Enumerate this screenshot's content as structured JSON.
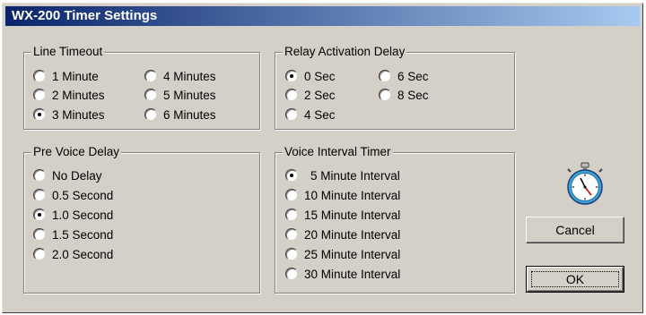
{
  "window": {
    "title": "WX-200 Timer Settings"
  },
  "line_timeout": {
    "label": "Line Timeout",
    "options": [
      "1 Minute",
      "2 Minutes",
      "3 Minutes",
      "4 Minutes",
      "5 Minutes",
      "6 Minutes"
    ],
    "selected": "3 Minutes"
  },
  "relay_activation_delay": {
    "label": "Relay Activation Delay",
    "options": [
      "0 Sec",
      "2 Sec",
      "4 Sec",
      "6 Sec",
      "8 Sec"
    ],
    "selected": "0 Sec"
  },
  "pre_voice_delay": {
    "label": "Pre Voice Delay",
    "options": [
      "No Delay",
      "0.5 Second",
      "1.0 Second",
      "1.5 Second",
      "2.0 Second"
    ],
    "selected": "1.0 Second"
  },
  "voice_interval_timer": {
    "label": "Voice Interval Timer",
    "options": [
      "5 Minute Interval",
      "10 Minute Interval",
      "15 Minute Interval",
      "20 Minute Interval",
      "25 Minute Interval",
      "30 Minute Interval"
    ],
    "selected": "5 Minute Interval"
  },
  "buttons": {
    "cancel": "Cancel",
    "ok": "OK"
  },
  "icons": {
    "stopwatch": "stopwatch-icon"
  }
}
